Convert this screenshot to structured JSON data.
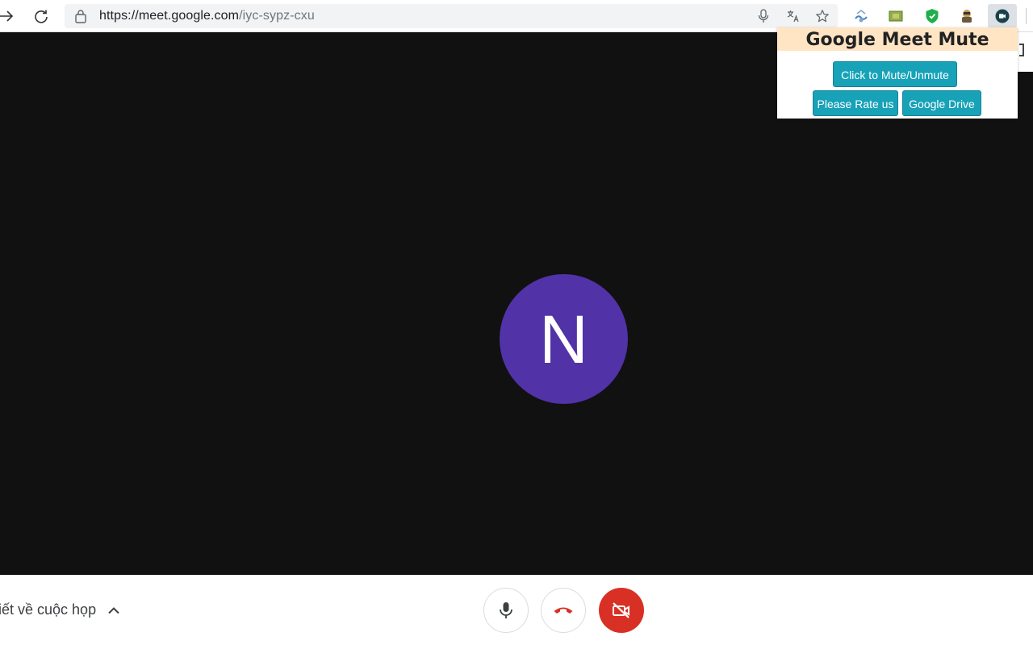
{
  "browser": {
    "url_domain": "https://meet.google.com",
    "url_path": "/iyc-sypz-cxu",
    "icons": {
      "forward": "forward-arrow-icon",
      "reload": "reload-icon",
      "lock": "lock-icon",
      "mic": "microphone-icon",
      "translate": "translate-icon",
      "bookmark": "star-icon"
    },
    "extensions": [
      "extension-icon-1",
      "extension-icon-2",
      "shield-extension-icon",
      "extension-icon-4",
      "meet-mute-extension-icon"
    ]
  },
  "popup": {
    "title": "Google Meet Mute",
    "mute_button": "Click to Mute/Unmute",
    "rate_button": "Please Rate us",
    "drive_button": "Google Drive",
    "colors": {
      "header_bg": "#ffe5c4",
      "button_bg": "#17a2b8"
    }
  },
  "meet": {
    "avatar_initial": "N",
    "avatar_color": "#5132a7",
    "meeting_details_label": "iết về cuộc họp",
    "controls": [
      "microphone-button",
      "leave-call-button",
      "camera-off-button"
    ],
    "colors": {
      "stage_bg": "#111111",
      "danger": "#d93025"
    }
  }
}
